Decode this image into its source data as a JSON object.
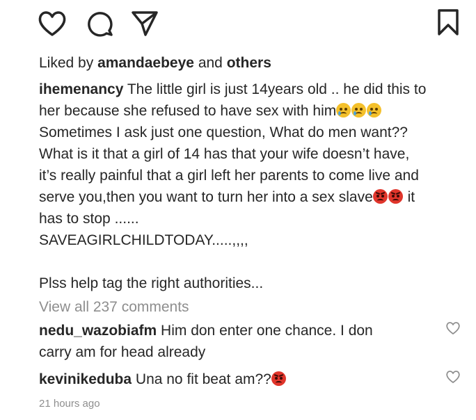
{
  "actions": {
    "like_icon": "heart-outline",
    "comment_icon": "speech-bubble",
    "share_icon": "paper-plane",
    "save_icon": "bookmark-outline"
  },
  "likes": {
    "prefix": "Liked by ",
    "user": "amandaebeye",
    "middle": " and ",
    "others": "others"
  },
  "caption": {
    "username": "ihemenancy",
    "lines": [
      " The little girl is just 14years old .. he did this to",
      "her because she refused to have sex with him",
      "Sometimes I ask just one question, What do men want??",
      "What is it that a girl of 14 has that your wife doesn’t have,",
      "it’s really painful that a girl left her parents to come live and",
      "serve you,then you want to turn her into a sex slave",
      " it",
      "has to stop ......",
      "SAVEAGIRLCHILDTODAY.....,,,,",
      "Plss help tag the right authorities..."
    ],
    "emojis": [
      "crying-face",
      "crying-face",
      "crying-face",
      "angry-face",
      "angry-face"
    ]
  },
  "view_all": "View all 237 comments",
  "comments": [
    {
      "user": "nedu_wazobiafm",
      "text_line1": " Him don enter one chance. I don",
      "text_line2": "carry am for head already",
      "emoji": ""
    },
    {
      "user": "kevinikeduba",
      "text_line1": " Una no fit beat am??",
      "text_line2": "",
      "emoji": "angry-face"
    }
  ],
  "timestamp": "21 hours ago",
  "colors": {
    "text": "#262626",
    "muted": "#8e8e8e",
    "background": "#ffffff"
  }
}
